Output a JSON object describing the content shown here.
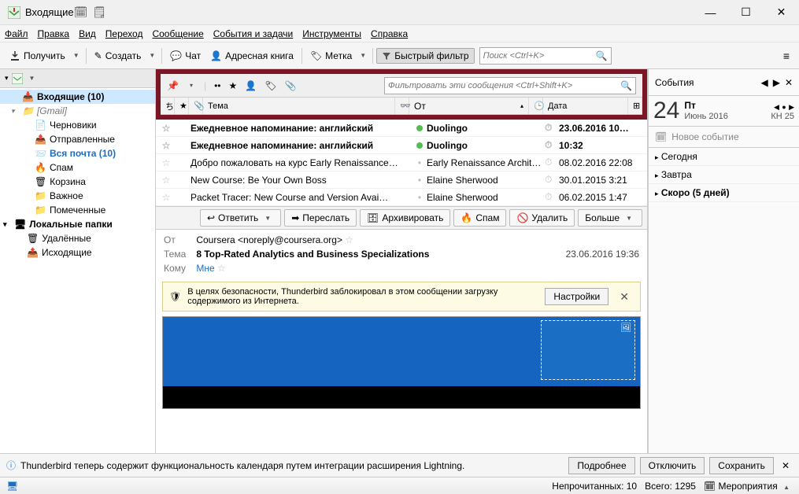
{
  "window": {
    "title": "Входящие"
  },
  "menubar": [
    "Файл",
    "Правка",
    "Вид",
    "Переход",
    "Сообщение",
    "События и задачи",
    "Инструменты",
    "Справка"
  ],
  "toolbar": {
    "get": "Получить",
    "compose": "Создать",
    "chat": "Чат",
    "address": "Адресная книга",
    "tag": "Метка",
    "qfilter": "Быстрый фильтр",
    "search_ph": "Поиск <Ctrl+K>"
  },
  "sidebar": {
    "items": [
      {
        "label": "Входящие (10)",
        "bold": true,
        "sel": true,
        "indent": 14,
        "icon": "inbox"
      },
      {
        "label": "[Gmail]",
        "gray": true,
        "indent": 14,
        "icon": "folder",
        "exp": true
      },
      {
        "label": "Черновики",
        "indent": 30,
        "icon": "drafts"
      },
      {
        "label": "Отправленные",
        "indent": 30,
        "icon": "sent"
      },
      {
        "label": "Вся почта (10)",
        "bold": true,
        "blue": true,
        "indent": 30,
        "icon": "all"
      },
      {
        "label": "Спам",
        "indent": 30,
        "icon": "spam"
      },
      {
        "label": "Корзина",
        "indent": 30,
        "icon": "trash"
      },
      {
        "label": "Важное",
        "indent": 30,
        "icon": "folder"
      },
      {
        "label": "Помеченные",
        "indent": 30,
        "icon": "folder"
      },
      {
        "label": "Локальные папки",
        "bold": true,
        "indent": 4,
        "icon": "local",
        "exp": true
      },
      {
        "label": "Удалённые",
        "indent": 20,
        "icon": "trash"
      },
      {
        "label": "Исходящие",
        "indent": 20,
        "icon": "outbox"
      }
    ]
  },
  "filters": {
    "placeholder": "Фильтровать эти сообщения <Ctrl+Shift+K>"
  },
  "columns": {
    "subject": "Тема",
    "from": "От",
    "date": "Дата"
  },
  "messages": [
    {
      "subject": "Ежедневное напоминание: английский",
      "from": "Duolingo",
      "date": "23.06.2016 10…",
      "bold": true,
      "dot": "green"
    },
    {
      "subject": "Ежедневное напоминание: английский",
      "from": "Duolingo",
      "date": "10:32",
      "bold": true,
      "dot": "green"
    },
    {
      "subject": "Добро пожаловать на курс Early Renaissance…",
      "from": "Early Renaissance Archite…",
      "date": "08.02.2016 22:08",
      "dot": "gray"
    },
    {
      "subject": "New Course: Be Your Own Boss",
      "from": "Elaine Sherwood",
      "date": "30.01.2015 3:21",
      "dot": "gray"
    },
    {
      "subject": "Packet Tracer: New Course and Version Avai…",
      "from": "Elaine Sherwood",
      "date": "06.02.2015 1:47",
      "dot": "gray"
    }
  ],
  "actions": {
    "reply": "Ответить",
    "forward": "Переслать",
    "archive": "Архивировать",
    "spam": "Спам",
    "delete": "Удалить",
    "more": "Больше"
  },
  "preview": {
    "from_label": "От",
    "from": "Coursera <noreply@coursera.org>",
    "subj_label": "Тема",
    "subject": "8 Top-Rated Analytics and Business Specializations",
    "to_label": "Кому",
    "to": "Мне",
    "date": "23.06.2016 19:36"
  },
  "security": {
    "text": "В целях безопасности, Thunderbird заблокировал в этом сообщении загрузку содержимого из Интернета.",
    "button": "Настройки"
  },
  "events": {
    "title": "События",
    "day": "24",
    "dow": "Пт",
    "month": "Июнь 2016",
    "week": "КН 25",
    "new": "Новое событие",
    "today": "Сегодня",
    "tomorrow": "Завтра",
    "soon": "Скоро (5 дней)"
  },
  "notif": {
    "text": "Thunderbird теперь содержит функциональность календаря путем интеграции расширения Lightning.",
    "more": "Подробнее",
    "off": "Отключить",
    "save": "Сохранить"
  },
  "status": {
    "unread": "Непрочитанных: 10",
    "total": "Всего: 1295",
    "agenda": "Мероприятия"
  }
}
